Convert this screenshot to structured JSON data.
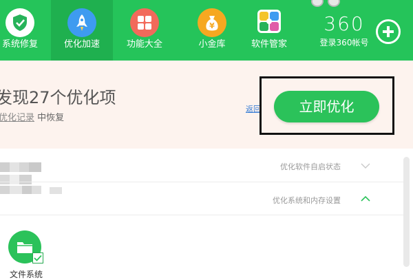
{
  "nav": {
    "items": [
      {
        "label": "系统修复",
        "icon": "shield-icon",
        "color": "#27b35a"
      },
      {
        "label": "优化加速",
        "icon": "rocket-icon",
        "color": "#3e9bf0",
        "active": true
      },
      {
        "label": "功能大全",
        "icon": "grid-icon",
        "color": "#f26a5b"
      },
      {
        "label": "小金库",
        "icon": "money-bag-icon",
        "color": "#f6a821"
      },
      {
        "label": "软件管家",
        "icon": "software-manager-icon",
        "color": "#f4c42b"
      }
    ]
  },
  "brand": {
    "logo": "360",
    "login": "登录360帐号"
  },
  "result": {
    "title": "发现27个优化项",
    "restore_link": "优化记录",
    "restore_suffix": "中恢复",
    "back": "返回",
    "optimize_button": "立即优化"
  },
  "categories": [
    {
      "label": "优化软件自启状态",
      "expanded": false
    },
    {
      "label": "优化系统和内存设置",
      "expanded": true
    }
  ],
  "items": [
    {
      "label": "文件系统",
      "checked": true
    }
  ],
  "colors": {
    "accent": "#25c45a",
    "highlight_border": "#111111"
  }
}
